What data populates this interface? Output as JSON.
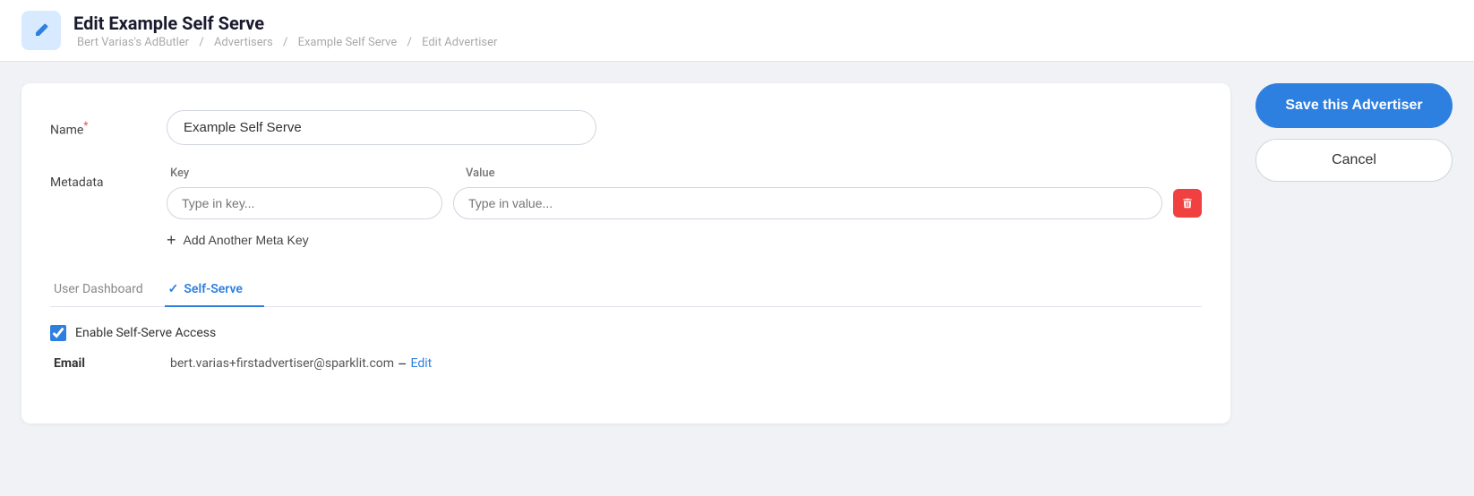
{
  "header": {
    "title": "Edit Example Self Serve",
    "icon_label": "edit-icon",
    "breadcrumb": [
      {
        "label": "Bert Varias's AdButler"
      },
      {
        "label": "Advertisers"
      },
      {
        "label": "Example Self Serve"
      },
      {
        "label": "Edit Advertiser"
      }
    ]
  },
  "form": {
    "name_label": "Name",
    "name_required": "*",
    "name_value": "Example Self Serve",
    "metadata_label": "Metadata",
    "meta_key_col": "Key",
    "meta_value_col": "Value",
    "meta_key_placeholder": "Type in key...",
    "meta_value_placeholder": "Type in value...",
    "add_meta_label": "Add Another Meta Key"
  },
  "tabs": [
    {
      "id": "user-dashboard",
      "label": "User Dashboard",
      "active": false,
      "check": false
    },
    {
      "id": "self-serve",
      "label": "Self-Serve",
      "active": true,
      "check": true
    }
  ],
  "self_serve_section": {
    "enable_label": "Enable Self-Serve Access",
    "enabled": true,
    "email_label": "Email",
    "email_value": "bert.varias+firstadvertiser@sparklit.com",
    "email_dash": "–",
    "email_edit": "Edit"
  },
  "actions": {
    "save_label": "Save this Advertiser",
    "cancel_label": "Cancel"
  },
  "colors": {
    "accent": "#2d7fe0",
    "delete": "#f04040"
  }
}
